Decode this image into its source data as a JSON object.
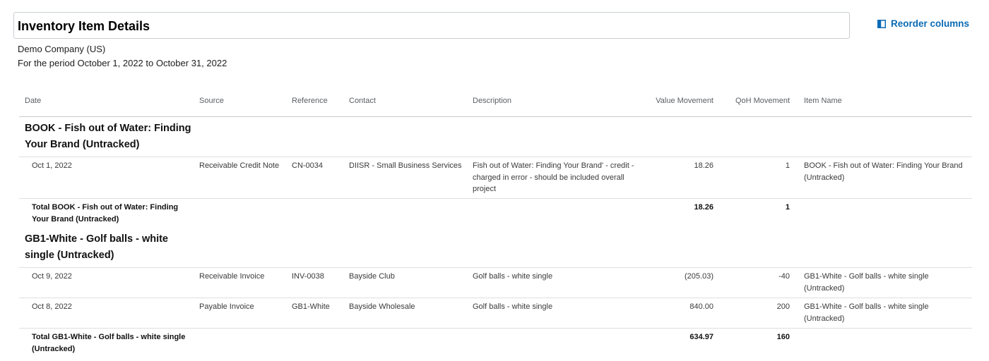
{
  "header": {
    "title": "Inventory Item Details",
    "reorder_label": "Reorder columns"
  },
  "subheader": {
    "company": "Demo Company (US)",
    "period": "For the period October 1, 2022 to October 31, 2022"
  },
  "columns": {
    "date": "Date",
    "source": "Source",
    "reference": "Reference",
    "contact": "Contact",
    "description": "Description",
    "value_movement": "Value Movement",
    "qoh_movement": "QoH Movement",
    "item_name": "Item Name"
  },
  "groups": [
    {
      "title": "BOOK - Fish out of Water: Finding Your Brand (Untracked)",
      "rows": [
        {
          "date": "Oct 1, 2022",
          "source": "Receivable Credit Note",
          "reference": "CN-0034",
          "contact": "DIISR - Small Business Services",
          "description": "Fish out of Water: Finding Your Brand' - credit - charged in error - should be included overall project",
          "value_movement": "18.26",
          "qoh_movement": "1",
          "item_name": "BOOK - Fish out of Water: Finding Your Brand (Untracked)"
        }
      ],
      "total": {
        "label": "Total BOOK - Fish out of Water: Finding Your Brand (Untracked)",
        "value_movement": "18.26",
        "qoh_movement": "1"
      }
    },
    {
      "title": "GB1-White - Golf balls - white single (Untracked)",
      "rows": [
        {
          "date": "Oct 9, 2022",
          "source": "Receivable Invoice",
          "reference": "INV-0038",
          "contact": "Bayside Club",
          "description": "Golf balls - white single",
          "value_movement": "(205.03)",
          "qoh_movement": "-40",
          "item_name": "GB1-White - Golf balls - white single (Untracked)"
        },
        {
          "date": "Oct 8, 2022",
          "source": "Payable Invoice",
          "reference": "GB1-White",
          "contact": "Bayside Wholesale",
          "description": "Golf balls - white single",
          "value_movement": "840.00",
          "qoh_movement": "200",
          "item_name": "GB1-White - Golf balls - white single (Untracked)"
        }
      ],
      "total": {
        "label": "Total GB1-White - Golf balls - white single (Untracked)",
        "value_movement": "634.97",
        "qoh_movement": "160"
      }
    }
  ],
  "colors": {
    "accent": "#0b6bb5",
    "border": "#c9cdd1"
  },
  "icons": {
    "reorder": "columns-icon"
  }
}
